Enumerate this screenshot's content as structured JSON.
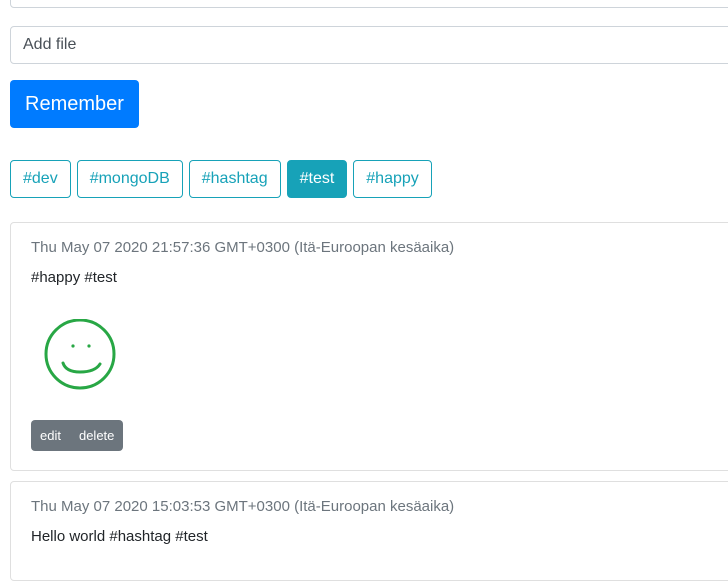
{
  "form": {
    "file_placeholder": "Add file",
    "submit_label": "Remember"
  },
  "tags": [
    {
      "label": "#dev",
      "active": false
    },
    {
      "label": "#mongoDB",
      "active": false
    },
    {
      "label": "#hashtag",
      "active": false
    },
    {
      "label": "#test",
      "active": true
    },
    {
      "label": "#happy",
      "active": false
    }
  ],
  "posts": [
    {
      "date": "Thu May 07 2020 21:57:36 GMT+0300 (Itä-Euroopan kesäaika)",
      "text": "#happy #test",
      "image": "smiley-drawing",
      "edit_label": "edit",
      "delete_label": "delete"
    },
    {
      "date": "Thu May 07 2020 15:03:53 GMT+0300 (Itä-Euroopan kesäaika)",
      "text": "Hello world #hashtag #test"
    }
  ],
  "colors": {
    "primary": "#007bff",
    "info": "#17a2b8",
    "secondary": "#6c757d",
    "smiley": "#28a745"
  }
}
